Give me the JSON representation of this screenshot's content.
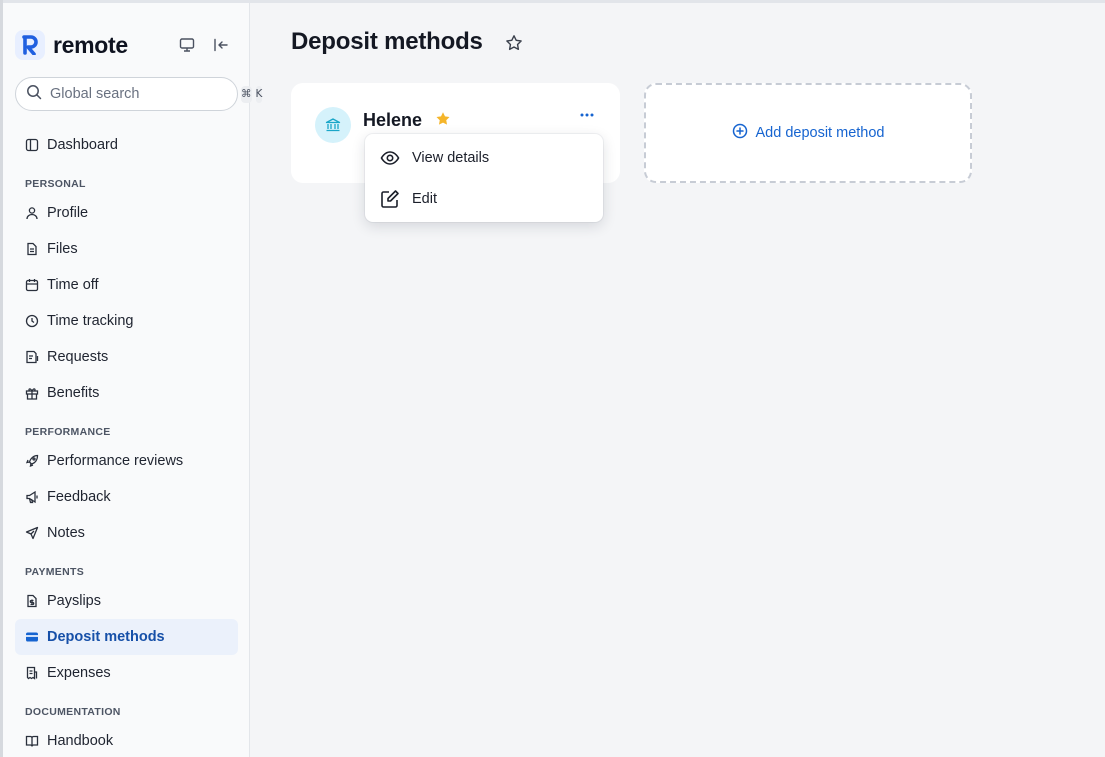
{
  "brand": {
    "name": "remote"
  },
  "search": {
    "placeholder": "Global search",
    "shortcut_keys": [
      "⌘",
      "K"
    ]
  },
  "sidebar": {
    "dashboard": {
      "label": "Dashboard"
    },
    "sections": [
      {
        "label": "PERSONAL"
      },
      {
        "label": "PERFORMANCE"
      },
      {
        "label": "PAYMENTS"
      },
      {
        "label": "DOCUMENTATION"
      }
    ],
    "items": [
      {
        "label": "Profile",
        "icon": "user-icon"
      },
      {
        "label": "Files",
        "icon": "file-icon"
      },
      {
        "label": "Time off",
        "icon": "calendar-icon"
      },
      {
        "label": "Time tracking",
        "icon": "clock-icon"
      },
      {
        "label": "Requests",
        "icon": "requests-icon"
      },
      {
        "label": "Benefits",
        "icon": "gift-icon"
      },
      {
        "label": "Performance reviews",
        "icon": "rocket-icon"
      },
      {
        "label": "Feedback",
        "icon": "megaphone-icon"
      },
      {
        "label": "Notes",
        "icon": "send-icon"
      },
      {
        "label": "Payslips",
        "icon": "payslip-icon"
      },
      {
        "label": "Deposit methods",
        "icon": "card-icon",
        "active": true
      },
      {
        "label": "Expenses",
        "icon": "receipt-icon"
      },
      {
        "label": "Handbook",
        "icon": "book-icon"
      }
    ]
  },
  "page": {
    "title": "Deposit methods"
  },
  "deposit_card": {
    "name": "Helene",
    "primary": true
  },
  "context_menu": {
    "items": [
      {
        "label": "View details",
        "icon": "eye-icon"
      },
      {
        "label": "Edit",
        "icon": "edit-icon"
      }
    ]
  },
  "add_card": {
    "label": "Add deposit method"
  },
  "colors": {
    "accent": "#1664d0",
    "active_bg": "#ebf1fb",
    "star": "#f5b52a",
    "bank_icon_bg": "#d5f2fb"
  }
}
